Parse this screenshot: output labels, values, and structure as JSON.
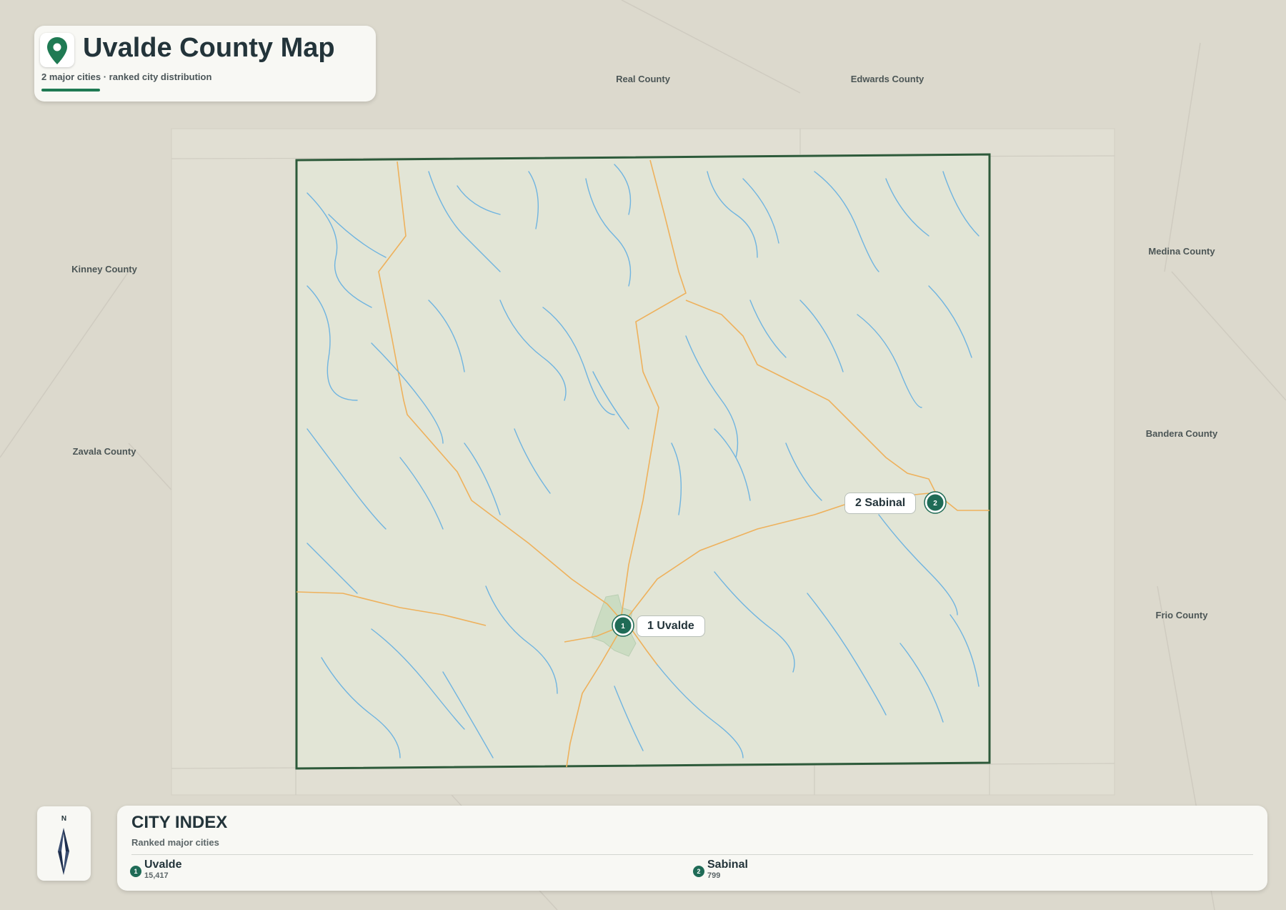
{
  "header": {
    "title": "Uvalde County Map",
    "subtitle": "2 major cities · ranked city distribution"
  },
  "counties": {
    "real": "Real County",
    "edwards": "Edwards County",
    "kinney": "Kinney County",
    "medina": "Medina County",
    "zavala": "Zavala County",
    "bandera": "Bandera County",
    "frio": "Frio County"
  },
  "map_labels": {
    "uvalde": "1 Uvalde",
    "sabinal": "2 Sabinal"
  },
  "compass": {
    "north": "N"
  },
  "city_index": {
    "title": "CITY INDEX",
    "subtitle": "Ranked major cities",
    "cities": [
      {
        "rank": "1",
        "name": "Uvalde",
        "population": "15,417"
      },
      {
        "rank": "2",
        "name": "Sabinal",
        "population": "799"
      }
    ]
  },
  "colors": {
    "county_border": "#2d5a3a",
    "river": "#6fb4e0",
    "road": "#eeb15c",
    "marker": "#1f6b56",
    "accent": "#1f7a53"
  },
  "icons": [
    "map-pin-icon",
    "compass-needle-icon"
  ]
}
